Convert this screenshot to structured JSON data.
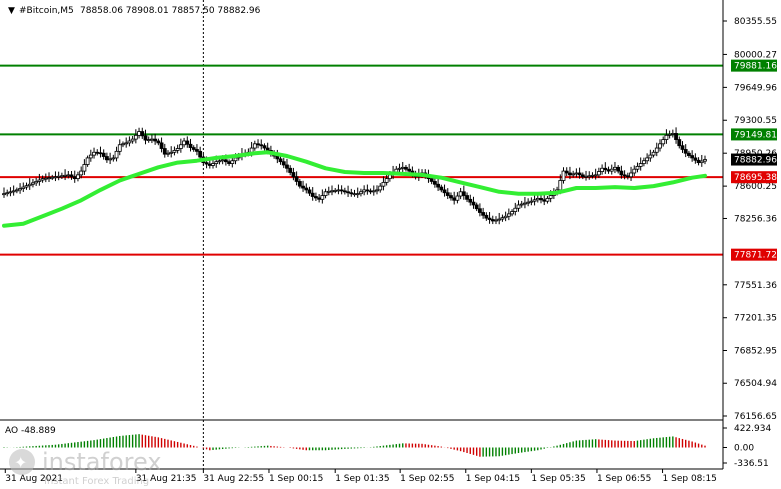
{
  "header": {
    "symbol": "#Bitcoin,M5",
    "ohlc": "78858.06 78908.01 78857.50 78882.96"
  },
  "colors": {
    "support_line": "#e00000",
    "resistance_line": "#008000",
    "moving_average": "#33ee33",
    "candle": "#000000",
    "ao_up": "#008000",
    "ao_down": "#d00000"
  },
  "chart_data": [
    {
      "type": "candlestick",
      "ylim": [
        76156.65,
        80355.55
      ],
      "y_ticks": [
        "80355.55",
        "80000.27",
        "79649.96",
        "79300.55",
        "78950.26",
        "78600.25",
        "78256.36",
        "77551.36",
        "77201.35",
        "76852.95",
        "76504.94",
        "76156.65"
      ],
      "x_ticks": [
        "31 Aug 2021",
        "31 Aug 21:35",
        "31 Aug 22:55",
        "1 Sep 00:15",
        "1 Sep 01:35",
        "1 Sep 02:55",
        "1 Sep 04:15",
        "1 Sep 05:35",
        "1 Sep 06:55",
        "1 Sep 08:15"
      ],
      "x_tick_positions": [
        0.2,
        20.5,
        31,
        41.2,
        51.5,
        61.6,
        71.8,
        82,
        92.2,
        102.4
      ],
      "vertical_separator_at": 31,
      "levels": [
        {
          "value": 79881.16,
          "label": "79881.16",
          "kind": "resistance"
        },
        {
          "value": 79149.81,
          "label": "79149.81",
          "kind": "resistance"
        },
        {
          "value": 78695.38,
          "label": "78695.38",
          "kind": "support"
        },
        {
          "value": 77871.72,
          "label": "77871.72",
          "kind": "support"
        }
      ],
      "current_price": {
        "value": 78882.96,
        "label": "78882.96"
      },
      "close_path": [
        [
          0,
          78520
        ],
        [
          2,
          78560
        ],
        [
          4,
          78620
        ],
        [
          6,
          78680
        ],
        [
          8,
          78700
        ],
        [
          10,
          78720
        ],
        [
          11,
          78680
        ],
        [
          12,
          78760
        ],
        [
          13,
          78900
        ],
        [
          14,
          78960
        ],
        [
          15,
          78950
        ],
        [
          16,
          78880
        ],
        [
          17,
          78900
        ],
        [
          18,
          79040
        ],
        [
          19,
          79060
        ],
        [
          20,
          79100
        ],
        [
          21,
          79180
        ],
        [
          22,
          79090
        ],
        [
          23,
          79100
        ],
        [
          24,
          79060
        ],
        [
          25,
          78940
        ],
        [
          26,
          78960
        ],
        [
          27,
          79000
        ],
        [
          28,
          79080
        ],
        [
          29,
          79010
        ],
        [
          30,
          78970
        ],
        [
          31,
          78850
        ],
        [
          32,
          78820
        ],
        [
          33,
          78860
        ],
        [
          34,
          78880
        ],
        [
          35,
          78840
        ],
        [
          36,
          78900
        ],
        [
          37,
          78940
        ],
        [
          38,
          78960
        ],
        [
          39,
          79050
        ],
        [
          40,
          79030
        ],
        [
          41,
          78980
        ],
        [
          42,
          78920
        ],
        [
          43,
          78860
        ],
        [
          44,
          78790
        ],
        [
          45,
          78700
        ],
        [
          46,
          78600
        ],
        [
          47,
          78560
        ],
        [
          48,
          78490
        ],
        [
          49,
          78460
        ],
        [
          50,
          78540
        ],
        [
          51,
          78550
        ],
        [
          52,
          78560
        ],
        [
          53,
          78540
        ],
        [
          54,
          78520
        ],
        [
          55,
          78520
        ],
        [
          56,
          78560
        ],
        [
          57,
          78540
        ],
        [
          58,
          78560
        ],
        [
          59,
          78640
        ],
        [
          60,
          78720
        ],
        [
          61,
          78780
        ],
        [
          62,
          78800
        ],
        [
          63,
          78760
        ],
        [
          64,
          78700
        ],
        [
          65,
          78740
        ],
        [
          66,
          78680
        ],
        [
          67,
          78620
        ],
        [
          68,
          78560
        ],
        [
          69,
          78500
        ],
        [
          70,
          78450
        ],
        [
          71,
          78540
        ],
        [
          72,
          78460
        ],
        [
          73,
          78400
        ],
        [
          74,
          78320
        ],
        [
          75,
          78260
        ],
        [
          76,
          78230
        ],
        [
          77,
          78250
        ],
        [
          78,
          78280
        ],
        [
          79,
          78330
        ],
        [
          80,
          78400
        ],
        [
          81,
          78420
        ],
        [
          82,
          78440
        ],
        [
          83,
          78470
        ],
        [
          84,
          78440
        ],
        [
          85,
          78500
        ],
        [
          86,
          78560
        ],
        [
          87,
          78760
        ],
        [
          88,
          78720
        ],
        [
          89,
          78740
        ],
        [
          90,
          78700
        ],
        [
          91,
          78710
        ],
        [
          92,
          78720
        ],
        [
          93,
          78790
        ],
        [
          94,
          78760
        ],
        [
          95,
          78800
        ],
        [
          96,
          78720
        ],
        [
          97,
          78700
        ],
        [
          98,
          78780
        ],
        [
          99,
          78840
        ],
        [
          100,
          78900
        ],
        [
          101,
          78960
        ],
        [
          102,
          79050
        ],
        [
          103,
          79140
        ],
        [
          104,
          79160
        ],
        [
          105,
          79030
        ],
        [
          106,
          78950
        ],
        [
          107,
          78900
        ],
        [
          108,
          78850
        ],
        [
          109,
          78882.96
        ]
      ],
      "ma_path": [
        [
          0,
          78180
        ],
        [
          3,
          78200
        ],
        [
          6,
          78280
        ],
        [
          9,
          78360
        ],
        [
          12,
          78450
        ],
        [
          15,
          78560
        ],
        [
          18,
          78660
        ],
        [
          21,
          78730
        ],
        [
          24,
          78800
        ],
        [
          27,
          78850
        ],
        [
          30,
          78870
        ],
        [
          33,
          78900
        ],
        [
          36,
          78920
        ],
        [
          39,
          78950
        ],
        [
          41,
          78960
        ],
        [
          44,
          78920
        ],
        [
          47,
          78860
        ],
        [
          50,
          78790
        ],
        [
          53,
          78750
        ],
        [
          56,
          78740
        ],
        [
          59,
          78740
        ],
        [
          62,
          78730
        ],
        [
          65,
          78720
        ],
        [
          68,
          78690
        ],
        [
          71,
          78640
        ],
        [
          74,
          78590
        ],
        [
          77,
          78540
        ],
        [
          80,
          78520
        ],
        [
          83,
          78520
        ],
        [
          86,
          78530
        ],
        [
          89,
          78580
        ],
        [
          92,
          78580
        ],
        [
          95,
          78590
        ],
        [
          98,
          78580
        ],
        [
          101,
          78600
        ],
        [
          104,
          78640
        ],
        [
          107,
          78690
        ],
        [
          109,
          78710
        ]
      ]
    },
    {
      "type": "bar",
      "name": "AO",
      "title": "AO -48.889",
      "y_ticks": [
        "422.934",
        "0.00",
        "-336.51"
      ],
      "ylim": [
        -336.51,
        422.934
      ],
      "profile": [
        [
          0,
          -10
        ],
        [
          8,
          60
        ],
        [
          14,
          160
        ],
        [
          18,
          250
        ],
        [
          21,
          290
        ],
        [
          24,
          220
        ],
        [
          27,
          120
        ],
        [
          30,
          20
        ],
        [
          32,
          -60
        ],
        [
          35,
          -20
        ],
        [
          38,
          10
        ],
        [
          41,
          40
        ],
        [
          44,
          0
        ],
        [
          47,
          -60
        ],
        [
          50,
          -60
        ],
        [
          53,
          -30
        ],
        [
          56,
          -10
        ],
        [
          59,
          40
        ],
        [
          62,
          90
        ],
        [
          65,
          80
        ],
        [
          68,
          20
        ],
        [
          71,
          -80
        ],
        [
          74,
          -200
        ],
        [
          77,
          -190
        ],
        [
          80,
          -120
        ],
        [
          83,
          -60
        ],
        [
          86,
          40
        ],
        [
          89,
          150
        ],
        [
          92,
          180
        ],
        [
          95,
          150
        ],
        [
          98,
          140
        ],
        [
          101,
          200
        ],
        [
          104,
          240
        ],
        [
          107,
          130
        ],
        [
          109,
          40
        ]
      ]
    }
  ]
}
